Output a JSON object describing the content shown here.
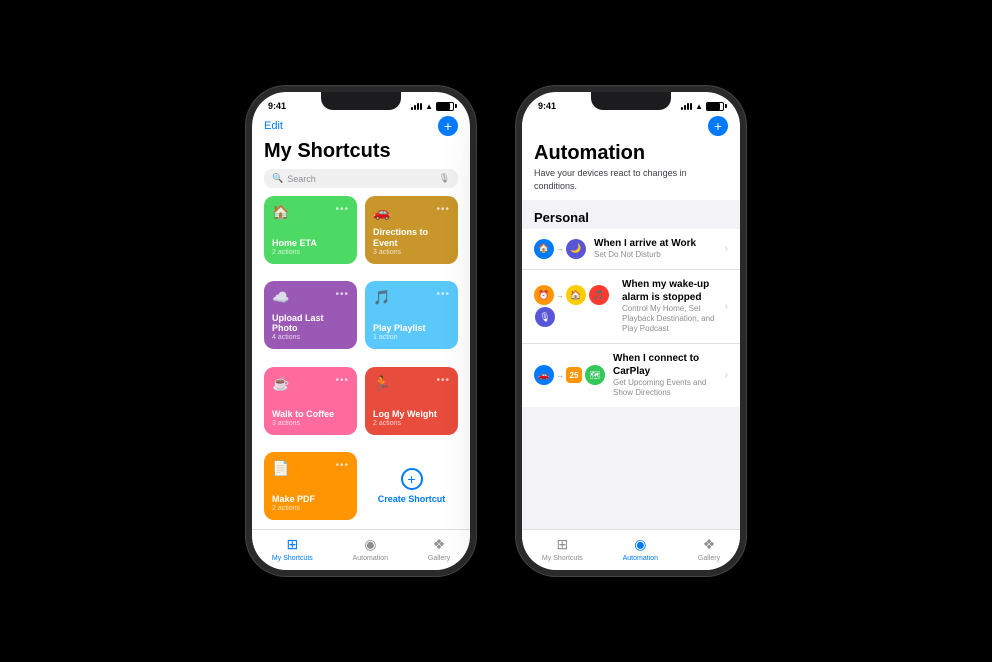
{
  "phone1": {
    "status": {
      "time": "9:41",
      "signal": "signal",
      "wifi": "wifi",
      "battery": "battery"
    },
    "header": {
      "edit_label": "Edit"
    },
    "title": "My Shortcuts",
    "search": {
      "placeholder": "Search"
    },
    "shortcuts": [
      {
        "id": "home-eta",
        "name": "Home ETA",
        "actions": "2 actions",
        "icon": "🏠",
        "color": "tile-green"
      },
      {
        "id": "directions-event",
        "name": "Directions to Event",
        "actions": "3 actions",
        "icon": "🚗",
        "color": "tile-amber"
      },
      {
        "id": "upload-photo",
        "name": "Upload Last Photo",
        "actions": "4 actions",
        "icon": "☁️",
        "color": "tile-purple"
      },
      {
        "id": "play-playlist",
        "name": "Play Playlist",
        "actions": "1 action",
        "icon": "♪",
        "color": "tile-teal"
      },
      {
        "id": "walk-coffee",
        "name": "Walk to Coffee",
        "actions": "3 actions",
        "icon": "☕",
        "color": "tile-pink"
      },
      {
        "id": "log-weight",
        "name": "Log My Weight",
        "actions": "2 actions",
        "icon": "🏃",
        "color": "tile-red"
      },
      {
        "id": "make-pdf",
        "name": "Make PDF",
        "actions": "2 actions",
        "icon": "📄",
        "color": "tile-orange"
      }
    ],
    "create_shortcut_label": "Create Shortcut",
    "nav": {
      "items": [
        {
          "id": "my-shortcuts",
          "label": "My Shortcuts",
          "active": true
        },
        {
          "id": "automation",
          "label": "Automation",
          "active": false
        },
        {
          "id": "gallery",
          "label": "Gallery",
          "active": false
        }
      ]
    }
  },
  "phone2": {
    "status": {
      "time": "9:41"
    },
    "title": "Automation",
    "subtitle": "Have your devices react to changes in conditions.",
    "section_label": "Personal",
    "automations": [
      {
        "id": "arrive-work",
        "title": "When I arrive at Work",
        "subtitle": "Set Do Not Disturb",
        "icons": [
          "🏠",
          "🌙"
        ],
        "icon_colors": [
          "bg-blue",
          "bg-purple"
        ]
      },
      {
        "id": "wake-alarm",
        "title": "When my wake-up alarm is stopped",
        "subtitle": "Control My Home, Set Playback Destination, and Play Podcast",
        "icons": [
          "⏰",
          "🏠",
          "🎵",
          "🎙"
        ],
        "icon_colors": [
          "bg-orange",
          "bg-yellow",
          "bg-red",
          "bg-purple"
        ]
      },
      {
        "id": "carplay",
        "title": "When I connect to CarPlay",
        "subtitle": "Get Upcoming Events and Show Directions",
        "icons": [
          "🚗",
          "25",
          "🗺"
        ],
        "icon_colors": [
          "bg-blue",
          "bg-orange",
          "bg-green"
        ]
      }
    ],
    "nav": {
      "items": [
        {
          "id": "my-shortcuts",
          "label": "My Shortcuts",
          "active": false
        },
        {
          "id": "automation",
          "label": "Automation",
          "active": true
        },
        {
          "id": "gallery",
          "label": "Gallery",
          "active": false
        }
      ]
    }
  }
}
